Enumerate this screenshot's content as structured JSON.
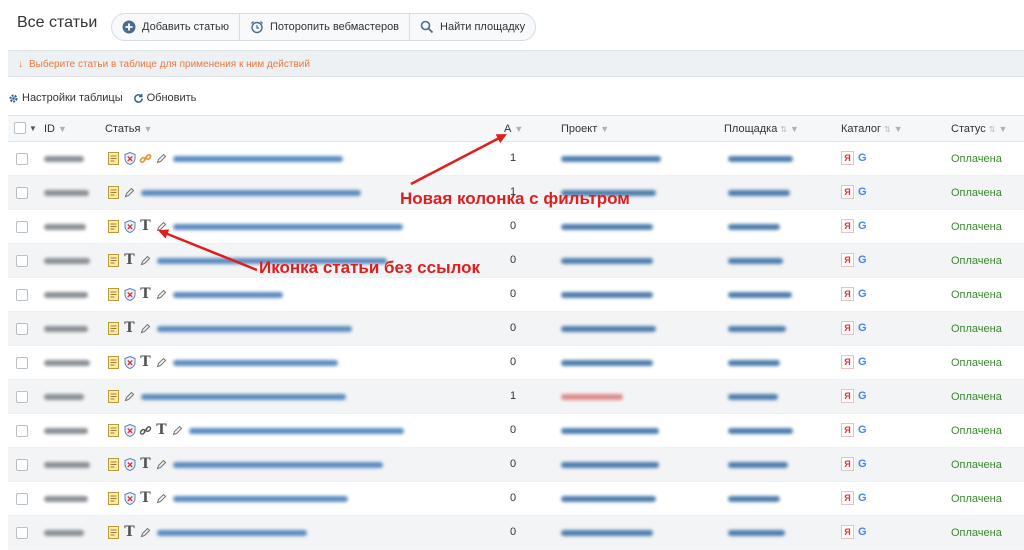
{
  "header": {
    "title": "Все статьи",
    "buttons": [
      {
        "label": "Добавить статью",
        "icon": "plus-circle-icon"
      },
      {
        "label": "Поторопить вебмастеров",
        "icon": "alarm-clock-icon"
      },
      {
        "label": "Найти площадку",
        "icon": "search-icon"
      }
    ]
  },
  "hint": {
    "text": "Выберите статьи в таблице для применения к ним действий",
    "color": "#e8793d"
  },
  "toolbar": {
    "settings_label": "Настройки таблицы",
    "refresh_label": "Обновить"
  },
  "table": {
    "columns": {
      "id": "ID",
      "article": "Статья",
      "a": "A",
      "project": "Проект",
      "site": "Площадка",
      "catalog": "Каталог",
      "status": "Статус"
    },
    "rows": [
      {
        "a": "1",
        "status": "Оплачена"
      },
      {
        "a": "1",
        "status": "Оплачена"
      },
      {
        "a": "0",
        "status": "Оплачена"
      },
      {
        "a": "0",
        "status": "Оплачена"
      },
      {
        "a": "0",
        "status": "Оплачена"
      },
      {
        "a": "0",
        "status": "Оплачена"
      },
      {
        "a": "0",
        "status": "Оплачена"
      },
      {
        "a": "1",
        "status": "Оплачена"
      },
      {
        "a": "0",
        "status": "Оплачена"
      },
      {
        "a": "0",
        "status": "Оплачена"
      },
      {
        "a": "0",
        "status": "Оплачена"
      },
      {
        "a": "0",
        "status": "Оплачена"
      }
    ],
    "catalog_marks": {
      "yandex": "Я",
      "google": "G"
    }
  },
  "annotations": {
    "new_column": "Новая колонка с фильтром",
    "no_links_icon": "Иконка статьи без ссылок",
    "color": "#e01e1e"
  }
}
